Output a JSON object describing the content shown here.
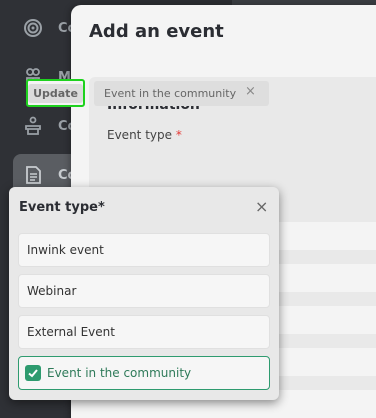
{
  "sidebar": {
    "items": [
      {
        "icon": "target-icon",
        "label": "Co"
      },
      {
        "icon": "people-icon",
        "label": "Me"
      },
      {
        "icon": "podium-icon",
        "label": "Co"
      },
      {
        "icon": "document-icon",
        "label": "Co"
      }
    ]
  },
  "modal": {
    "title": "Add an event",
    "section_title": "Information",
    "field_label": "Event type",
    "required_mark": "*",
    "update_label": "Update",
    "selected_value": "Event in the community",
    "remove_symbol": "×"
  },
  "dropdown": {
    "title": "Event type*",
    "close_symbol": "×",
    "options": [
      {
        "label": "Inwink event",
        "selected": false
      },
      {
        "label": "Webinar",
        "selected": false
      },
      {
        "label": "External Event",
        "selected": false
      },
      {
        "label": "Event in the community",
        "selected": true
      }
    ]
  },
  "colors": {
    "accent_green": "#2e9b6f",
    "highlight_green": "#1ed21e",
    "required_red": "#e53935"
  }
}
